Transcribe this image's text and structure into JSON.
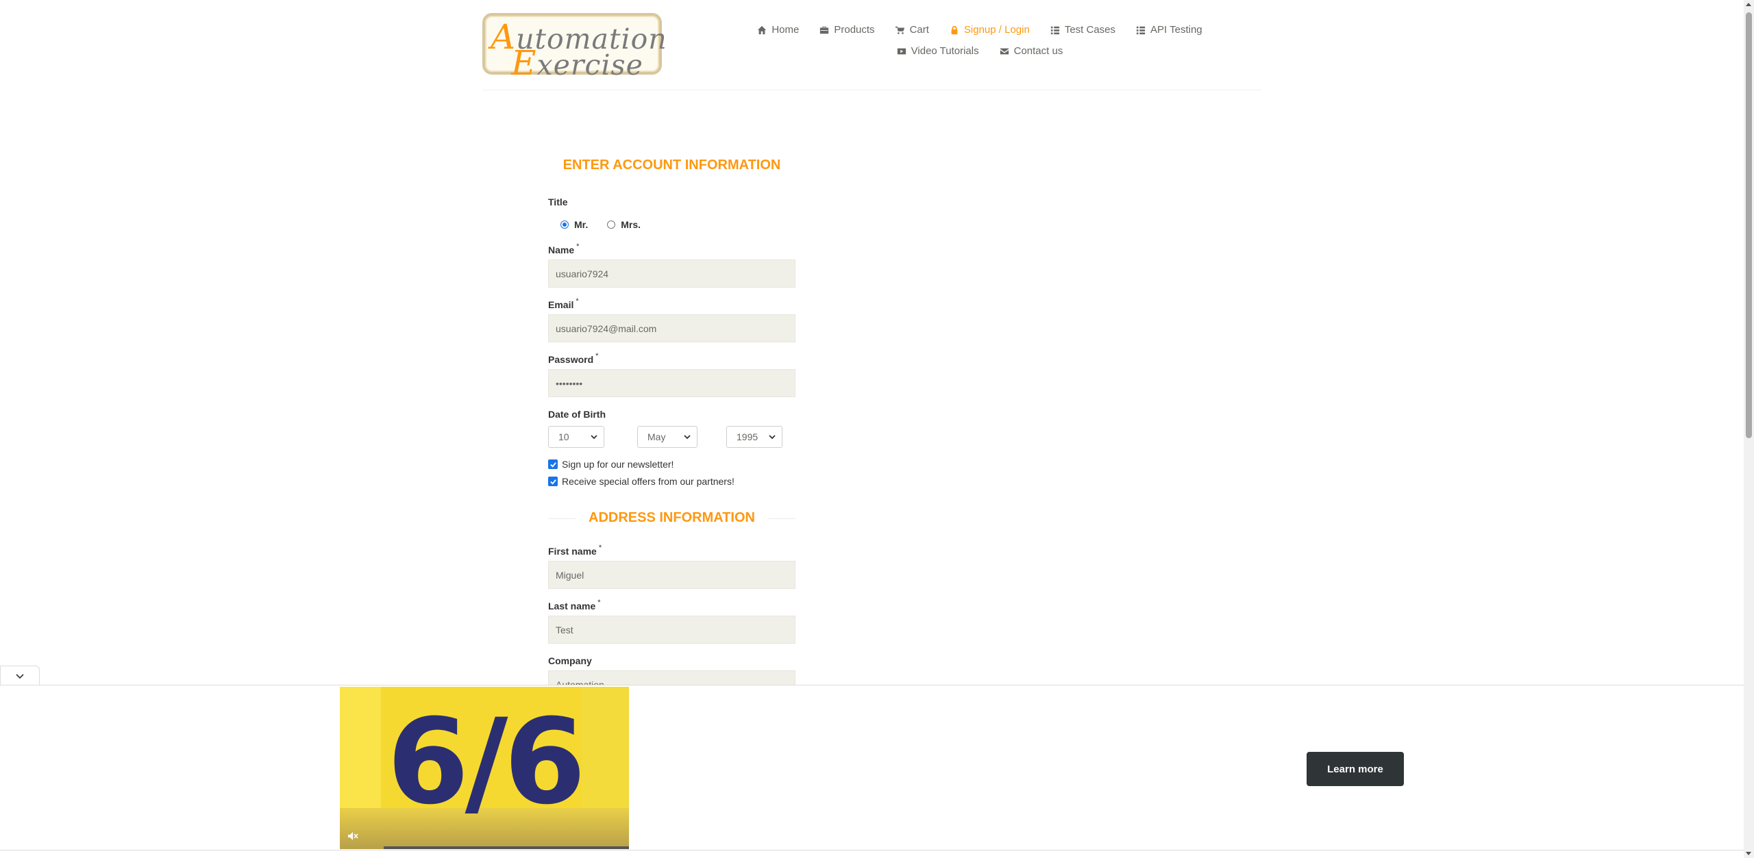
{
  "logo": {
    "line1_cap": "A",
    "line1_rest": "utomation",
    "line2_cap": "E",
    "line2_rest": "xercise"
  },
  "nav": {
    "row1": [
      {
        "label": "Home",
        "icon": "home-icon"
      },
      {
        "label": "Products",
        "icon": "products-icon"
      },
      {
        "label": "Cart",
        "icon": "cart-icon"
      },
      {
        "label": "Signup / Login",
        "icon": "lock-icon",
        "active": true
      },
      {
        "label": "Test Cases",
        "icon": "list-icon"
      },
      {
        "label": "API Testing",
        "icon": "list-icon"
      }
    ],
    "row2": [
      {
        "label": "Video Tutorials",
        "icon": "youtube-icon"
      },
      {
        "label": "Contact us",
        "icon": "envelope-icon"
      }
    ]
  },
  "form": {
    "heading": "ENTER ACCOUNT INFORMATION",
    "title_label": "Title",
    "title_options": [
      "Mr.",
      "Mrs."
    ],
    "title_selected": "Mr.",
    "name_label": "Name",
    "name_value": "usuario7924",
    "email_label": "Email",
    "email_value": "usuario7924@mail.com",
    "password_label": "Password",
    "password_value": "••••••••",
    "dob_label": "Date of Birth",
    "dob_day": "10",
    "dob_month": "May",
    "dob_year": "1995",
    "newsletter_label": "Sign up for our newsletter!",
    "newsletter_checked": true,
    "offers_label": "Receive special offers from our partners!",
    "offers_checked": true,
    "address_heading": "ADDRESS INFORMATION",
    "first_name_label": "First name",
    "first_name_value": "Miguel",
    "last_name_label": "Last name",
    "last_name_value": "Test",
    "company_label": "Company",
    "company_value": "Automation",
    "required_mark": "*"
  },
  "ad": {
    "video_text": "6/6",
    "button_label": "Learn more"
  },
  "colors": {
    "accent": "#fe980f",
    "text": "#696763",
    "field_bg": "#f0f0e9",
    "check": "#1a73e8"
  }
}
